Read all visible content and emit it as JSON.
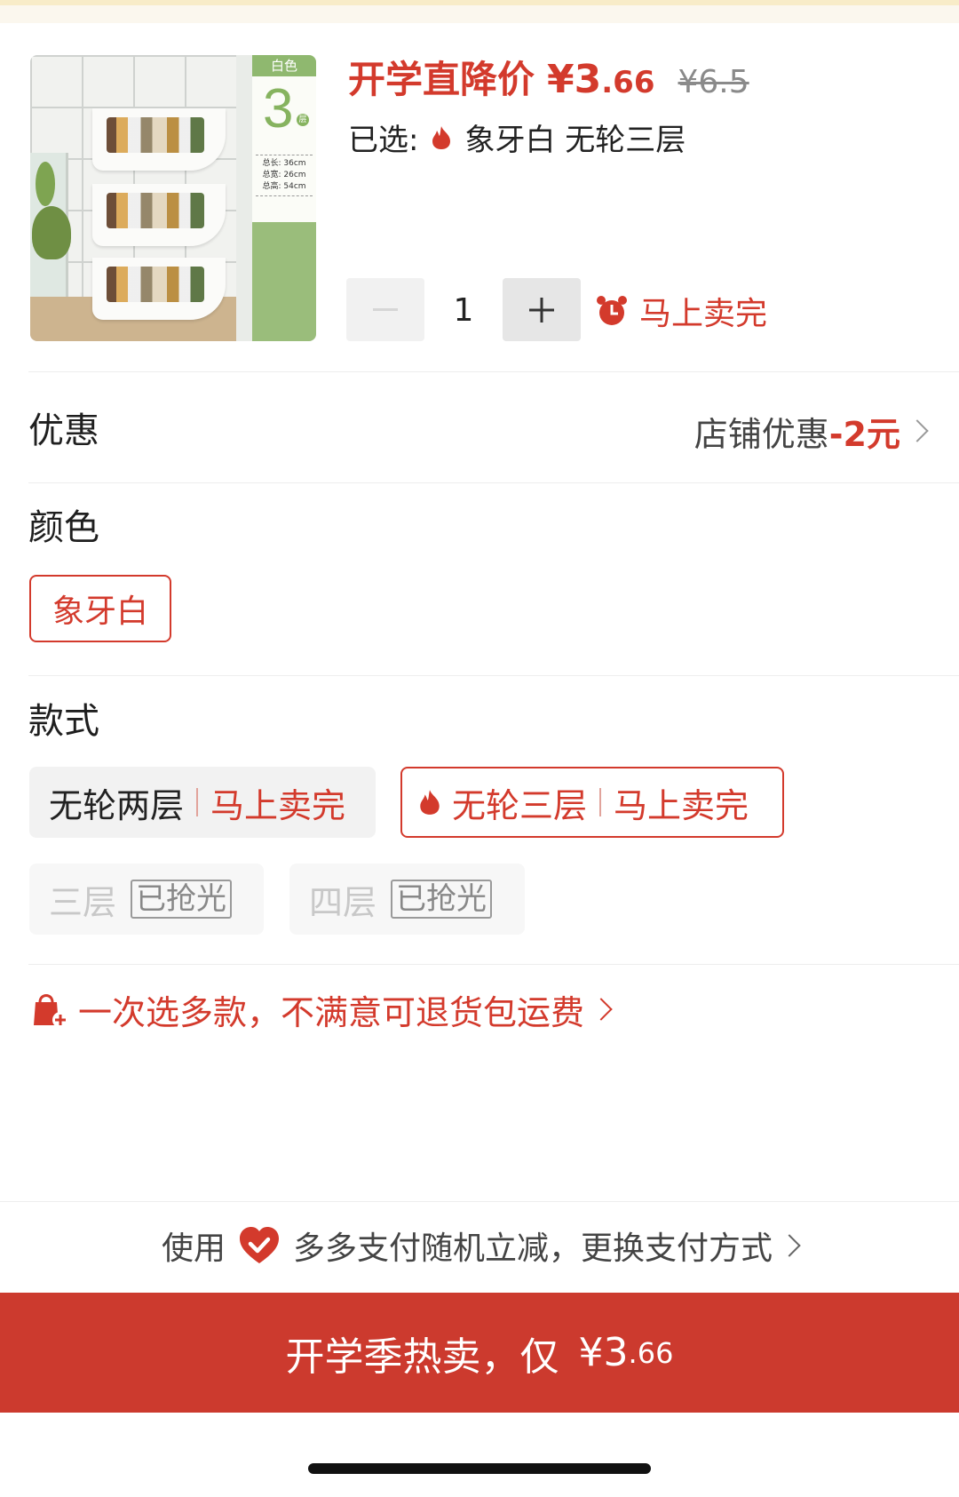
{
  "header": {
    "price_label": "开学直降价",
    "price_currency": "¥",
    "price_int": "3",
    "price_dec": ".66",
    "original_price": "¥6.5",
    "selected_label": "已选:",
    "selected_value": "象牙白 无轮三层"
  },
  "product_image": {
    "badge_color": "白色",
    "badge_number": "3",
    "badge_unit": "层",
    "dims": [
      "总长: 36cm",
      "总宽: 26cm",
      "总高: 54cm"
    ]
  },
  "quantity": {
    "minus": "−",
    "value": "1",
    "plus": "+",
    "stock_hint": "马上卖完"
  },
  "promotion": {
    "title": "优惠",
    "store_text": "店铺优惠",
    "amount": "-2元"
  },
  "color_section": {
    "title": "颜色",
    "options": [
      "象牙白"
    ]
  },
  "style_section": {
    "title": "款式",
    "options": [
      {
        "name": "无轮两层",
        "hint": "马上卖完",
        "state": "available"
      },
      {
        "name": "无轮三层",
        "hint": "马上卖完",
        "state": "selected"
      },
      {
        "name": "三层",
        "hint": "已抢光",
        "state": "soldout"
      },
      {
        "name": "四层",
        "hint": "已抢光",
        "state": "soldout"
      }
    ]
  },
  "return_notice": "一次选多款，不满意可退货包运费",
  "payment": {
    "prefix": "使用",
    "text": "多多支付随机立减，更换支付方式"
  },
  "buy_button": {
    "label": "开学季热卖，仅",
    "currency": "¥",
    "int": "3",
    "dec": ".66"
  },
  "colors": {
    "accent": "#d33a2c",
    "buy_bg": "#cc3a2e"
  }
}
